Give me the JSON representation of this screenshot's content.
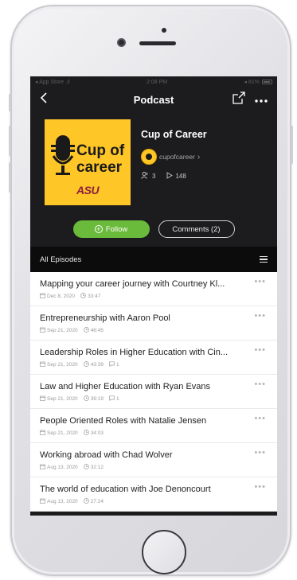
{
  "status_bar": {
    "carrier": "◂ App Store .ıl",
    "time": "2:08 PM",
    "battery": "◂ 81%"
  },
  "nav": {
    "title": "Podcast"
  },
  "podcast": {
    "cover": {
      "line1": "Cup of",
      "line2": "career",
      "org": "ASU"
    },
    "name": "Cup of Career",
    "author": "cupofcareer",
    "subscribers": "3",
    "plays": "148"
  },
  "actions": {
    "follow_label": "Follow",
    "comments_label": "Comments (2)"
  },
  "episodes": {
    "header": "All Episodes",
    "items": [
      {
        "title": "Mapping your career journey with Courtney Kl...",
        "date": "Dec 8, 2020",
        "duration": "33:47",
        "comments": ""
      },
      {
        "title": "Entrepreneurship with Aaron Pool",
        "date": "Sep 21, 2020",
        "duration": "46:45",
        "comments": ""
      },
      {
        "title": "Leadership Roles in Higher Education with Cin...",
        "date": "Sep 21, 2020",
        "duration": "43:39",
        "comments": "1"
      },
      {
        "title": "Law and Higher Education with Ryan Evans",
        "date": "Sep 21, 2020",
        "duration": "39:19",
        "comments": "1"
      },
      {
        "title": "People Oriented Roles with Natalie Jensen",
        "date": "Sep 21, 2020",
        "duration": "34:03",
        "comments": ""
      },
      {
        "title": "Working abroad with Chad Wolver",
        "date": "Aug 13, 2020",
        "duration": "32:12",
        "comments": ""
      },
      {
        "title": "The world of education with Joe Denoncourt",
        "date": "Aug 13, 2020",
        "duration": "27:24",
        "comments": ""
      }
    ]
  },
  "colors": {
    "accent_follow": "#6aba3b",
    "cover_bg": "#ffc627",
    "asu_maroon": "#8c1d40",
    "header_bg": "#1c1c1e"
  }
}
